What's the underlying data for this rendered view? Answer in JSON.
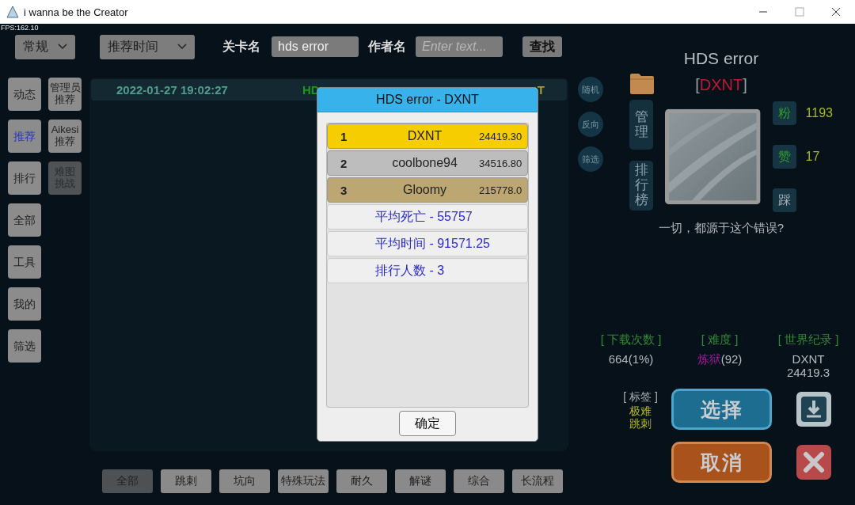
{
  "window": {
    "title": "i wanna be the Creator"
  },
  "fps": "FPS:162.10",
  "toolbar": {
    "category_dropdown": "常规",
    "sort_dropdown": "推荐时间",
    "level_name_label": "关卡名",
    "level_name_value": "hds error",
    "author_label": "作者名",
    "author_placeholder": "Enter text...",
    "search_button": "查找"
  },
  "sidebar": {
    "main_items": [
      {
        "label": "动态",
        "selected": false
      },
      {
        "label": "推荐",
        "selected": true
      },
      {
        "label": "排行",
        "selected": false
      },
      {
        "label": "全部",
        "selected": false
      },
      {
        "label": "工具",
        "selected": false
      },
      {
        "label": "我的",
        "selected": false
      },
      {
        "label": "筛选",
        "selected": false
      }
    ],
    "extra_items": [
      {
        "lines": [
          "管理员",
          "推荐"
        ],
        "dimmed": false
      },
      {
        "lines": [
          "Aikesi",
          "推荐"
        ],
        "dimmed": false
      },
      {
        "lines": [
          "难图",
          "挑战"
        ],
        "dimmed": true
      }
    ]
  },
  "list": {
    "rows": [
      {
        "date": "2022-01-27 19:02:27",
        "title": "HD",
        "author": "T"
      }
    ]
  },
  "categories": [
    {
      "label": "全部",
      "selected": true
    },
    {
      "label": "跳刺",
      "selected": false
    },
    {
      "label": "坑向",
      "selected": false
    },
    {
      "label": "特殊玩法",
      "selected": false
    },
    {
      "label": "耐久",
      "selected": false
    },
    {
      "label": "解谜",
      "selected": false
    },
    {
      "label": "综合",
      "selected": false
    },
    {
      "label": "长流程",
      "selected": false
    }
  ],
  "circle_buttons": [
    "随机",
    "反向",
    "筛选"
  ],
  "detail": {
    "title": "HDS error",
    "author": {
      "open": "[",
      "name": "DXNT",
      "close": "]"
    },
    "side_buttons": [
      "管理",
      "排行榜"
    ],
    "reactions": [
      {
        "label": "粉",
        "count": "1193",
        "on": true
      },
      {
        "label": "赞",
        "count": "17",
        "on": true
      },
      {
        "label": "踩",
        "on": false
      }
    ],
    "description": "一切，都源于这个错误?",
    "downloads": {
      "label": "[ 下载次数 ]",
      "value": "664(1%)"
    },
    "difficulty": {
      "label": "[ 难度 ]",
      "name": "炼狱",
      "value": "(92)"
    },
    "world_record": {
      "label": "[ 世界纪录 ]",
      "holder": "DXNT",
      "time": "24419.3"
    },
    "tags": {
      "label": "[ 标签 ]",
      "items": [
        "极难",
        "跳刺"
      ]
    },
    "select_button": "选择",
    "cancel_button": "取消"
  },
  "dialog": {
    "title": "HDS error - DXNT",
    "ranks": [
      {
        "rank": "1",
        "name": "DXNT",
        "time": "24419.30",
        "color": "#f5cd00"
      },
      {
        "rank": "2",
        "name": "coolbone94",
        "time": "34516.80",
        "color": "#bdbdbd"
      },
      {
        "rank": "3",
        "name": "Gloomy",
        "time": "215778.0",
        "color": "#bca772"
      }
    ],
    "stats": [
      "平均死亡 - 55757",
      "平均时间 - 91571.25",
      "排行人数 - 3"
    ],
    "ok_button": "确定"
  }
}
